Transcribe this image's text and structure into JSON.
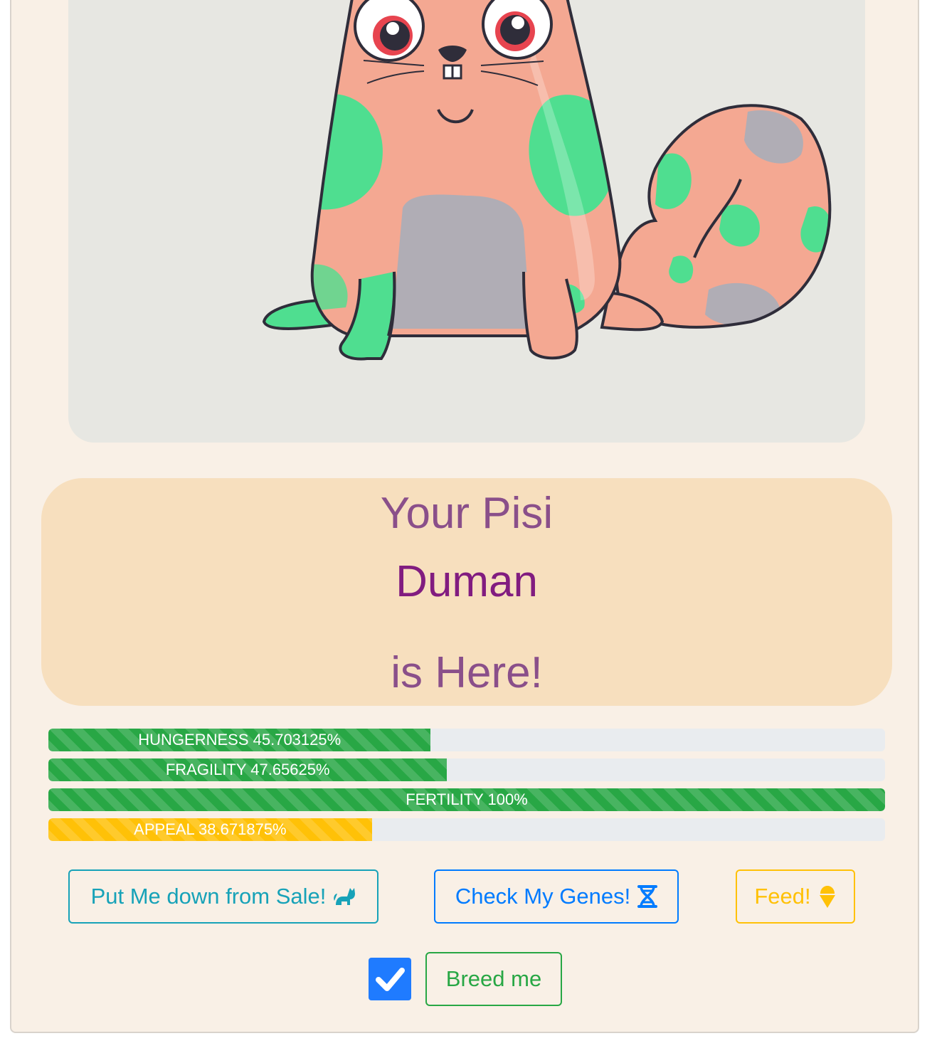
{
  "title": {
    "line1": "Your Pisi",
    "name": "Duman",
    "line3": "is Here!"
  },
  "stats": [
    {
      "label": "HUNGERNESS 45.703125%",
      "value_percent": 45.703125,
      "color": "#28a745"
    },
    {
      "label": "FRAGILITY 47.65625%",
      "value_percent": 47.65625,
      "color": "#28a745"
    },
    {
      "label": "FERTILITY 100%",
      "value_percent": 100,
      "color": "#28a745"
    },
    {
      "label": "APPEAL 38.671875%",
      "value_percent": 38.671875,
      "color": "#ffc107"
    }
  ],
  "buttons": {
    "sale_label": "Put Me down from Sale!",
    "sale_icon": "cat-icon",
    "genes_label": "Check My Genes!",
    "genes_icon": "dna-icon",
    "feed_label": "Feed!",
    "feed_icon": "ice-cream-icon",
    "breed_label": "Breed me"
  },
  "breed_checkbox": {
    "checked": true
  },
  "colors": {
    "card_background": "#f9f0e6",
    "image_background": "#e7e7e2",
    "title_box": "#f7dfbe",
    "title_text": "#8a4f8a",
    "name_text": "#811c80",
    "cat_body": "#f4a892",
    "cat_pattern": "#4fde90",
    "cat_belly": "#b0adb5"
  }
}
